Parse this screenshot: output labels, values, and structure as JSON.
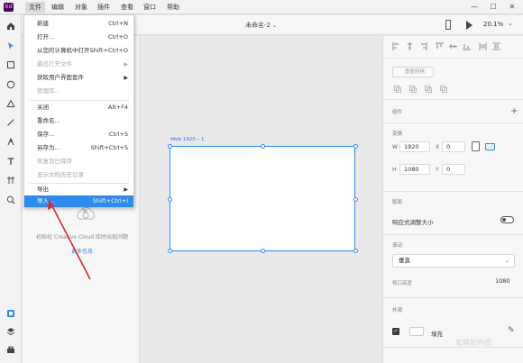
{
  "app": {
    "logo_text": "Xd"
  },
  "menubar": {
    "items": [
      "文件",
      "编辑",
      "对象",
      "插件",
      "查看",
      "窗口",
      "帮助"
    ],
    "window_controls": [
      "—",
      "☐",
      "✕"
    ]
  },
  "toolbar": {
    "doc_title": "未命名-2",
    "zoom": "20.1%"
  },
  "file_menu": {
    "items": [
      {
        "label": "新建",
        "shortcut": "Ctrl+N",
        "disabled": false
      },
      {
        "label": "打开...",
        "shortcut": "Ctrl+O",
        "disabled": false
      },
      {
        "label": "从您的计算机中打开...",
        "shortcut": "Shift+Ctrl+O",
        "disabled": false
      },
      {
        "label": "最近打开文件",
        "shortcut": "",
        "disabled": true,
        "submenu": true
      },
      {
        "label": "获取用户界面套件",
        "shortcut": "",
        "disabled": false,
        "submenu": true
      },
      {
        "label": "管理库...",
        "shortcut": "",
        "disabled": true
      },
      {
        "label": "关闭",
        "shortcut": "Alt+F4",
        "disabled": false
      },
      {
        "label": "重命名...",
        "shortcut": "",
        "disabled": false
      },
      {
        "label": "保存...",
        "shortcut": "Ctrl+S",
        "disabled": false
      },
      {
        "label": "另存为...",
        "shortcut": "Shift+Ctrl+S",
        "disabled": false
      },
      {
        "label": "恢复到已保存",
        "shortcut": "",
        "disabled": true
      },
      {
        "label": "显示文档历史记录",
        "shortcut": "",
        "disabled": true
      },
      {
        "label": "导出",
        "shortcut": "",
        "disabled": false,
        "submenu": true
      },
      {
        "label": "导入...",
        "shortcut": "Shift+Ctrl+I",
        "disabled": false,
        "highlight": true
      }
    ]
  },
  "left_panel": {
    "cc_message": "初始化 Creative Cloud 库时出现问题",
    "cc_link": "更多信息"
  },
  "canvas": {
    "artboard_label": "Web 1920 – 1"
  },
  "right_panel": {
    "repeat_grid": "重复网格",
    "component_heading": "组件",
    "transform_heading": "变换",
    "w_label": "W",
    "w_value": "1920",
    "x_label": "X",
    "x_value": "0",
    "h_label": "H",
    "h_value": "1080",
    "y_label": "Y",
    "y_value": "0",
    "grid_heading": "版面",
    "responsive_label": "响应式调整大小",
    "scroll_heading": "滚动",
    "scroll_value": "垂直",
    "viewport_label": "视口高度",
    "viewport_value": "1080",
    "appearance_heading": "外观",
    "fill_label": "填充"
  },
  "watermark": "安塔软件园",
  "colors": {
    "accent": "#2d8ceb",
    "annotation_arrow": "#e0262b"
  }
}
